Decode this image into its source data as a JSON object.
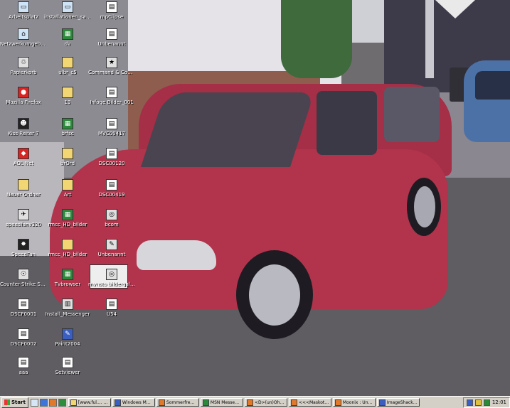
{
  "desktop_icons": [
    {
      "label": "Arbeitsplatz",
      "glyph": "▭",
      "type": "pc"
    },
    {
      "label": "Netzwerkumgebung",
      "glyph": "⌂",
      "type": "pc"
    },
    {
      "label": "Papierkorb",
      "glyph": "♲",
      "type": "prog"
    },
    {
      "label": "Mozilla Firefox",
      "glyph": "●",
      "type": "red"
    },
    {
      "label": "Kiss Reiter 7",
      "glyph": "☻",
      "type": "dark"
    },
    {
      "label": "AOL Net",
      "glyph": "◆",
      "type": "red"
    },
    {
      "label": "Neuer Ordner",
      "glyph": "",
      "type": "folder"
    },
    {
      "label": "speedfanv320",
      "glyph": "✈",
      "type": "prog"
    },
    {
      "label": "SpeedFan",
      "glyph": "✸",
      "type": "dark"
    },
    {
      "label": "Counter-Strike Source",
      "glyph": "☉",
      "type": "prog"
    },
    {
      "label": "DSCF0001",
      "glyph": "▤",
      "type": "doc"
    },
    {
      "label": "DSCF0002",
      "glyph": "▤",
      "type": "doc"
    },
    {
      "label": "aaa",
      "glyph": "▤",
      "type": "doc"
    },
    {
      "label": "installationen_sauvo",
      "glyph": "▭",
      "type": "pc"
    },
    {
      "label": "dv",
      "glyph": "▦",
      "type": "green"
    },
    {
      "label": "ulbr_c5",
      "glyph": "",
      "type": "folder"
    },
    {
      "label": "13",
      "glyph": "",
      "type": "folder"
    },
    {
      "label": "brfsc",
      "glyph": "▦",
      "type": "green"
    },
    {
      "label": "brOrd",
      "glyph": "",
      "type": "folder"
    },
    {
      "label": "Art",
      "glyph": "",
      "type": "folder"
    },
    {
      "label": "rmcc_HD_bilder",
      "glyph": "▦",
      "type": "green"
    },
    {
      "label": "rmcc_HD_bilder",
      "glyph": "",
      "type": "folder"
    },
    {
      "label": "Tvbrowser",
      "glyph": "▦",
      "type": "green"
    },
    {
      "label": "Install_Messenger",
      "glyph": "▥",
      "type": "prog"
    },
    {
      "label": "Paint2004",
      "glyph": "✎",
      "type": "blue"
    },
    {
      "label": "Setviewer",
      "glyph": "▤",
      "type": "doc"
    },
    {
      "label": "mpClipse",
      "glyph": "▤",
      "type": "doc"
    },
    {
      "label": "Unbenannt",
      "glyph": "▤",
      "type": "doc"
    },
    {
      "label": "Command & Conquer Generäle Die Stun...",
      "glyph": "★",
      "type": "prog"
    },
    {
      "label": "Infoge Bilder_001",
      "glyph": "▤",
      "type": "doc"
    },
    {
      "label": "MVC00417",
      "glyph": "▤",
      "type": "doc"
    },
    {
      "label": "DSC00120",
      "glyph": "▤",
      "type": "doc"
    },
    {
      "label": "DSC00419",
      "glyph": "▤",
      "type": "doc"
    },
    {
      "label": "bcom",
      "glyph": "◎",
      "type": "prog"
    },
    {
      "label": "Unbenannt",
      "glyph": "✎",
      "type": "prog"
    },
    {
      "label": "mynsto bildergalle..",
      "glyph": "◎",
      "type": "prog"
    },
    {
      "label": "U54",
      "glyph": "▤",
      "type": "doc"
    }
  ],
  "taskbar": {
    "start_label": "Start",
    "tasks": [
      {
        "label": "[www.ful.... full tub"
      },
      {
        "label": "Windows Media..."
      },
      {
        "label": "Sommerfrendl..."
      },
      {
        "label": "MSN Messenger"
      },
      {
        "label": "<D>(un)Ohne Ln..."
      },
      {
        "label": "<<<Maskotz>>>..."
      },
      {
        "label": "Moonix : Unter..."
      },
      {
        "label": "ImageShack - ..."
      }
    ],
    "clock": "12:01"
  }
}
